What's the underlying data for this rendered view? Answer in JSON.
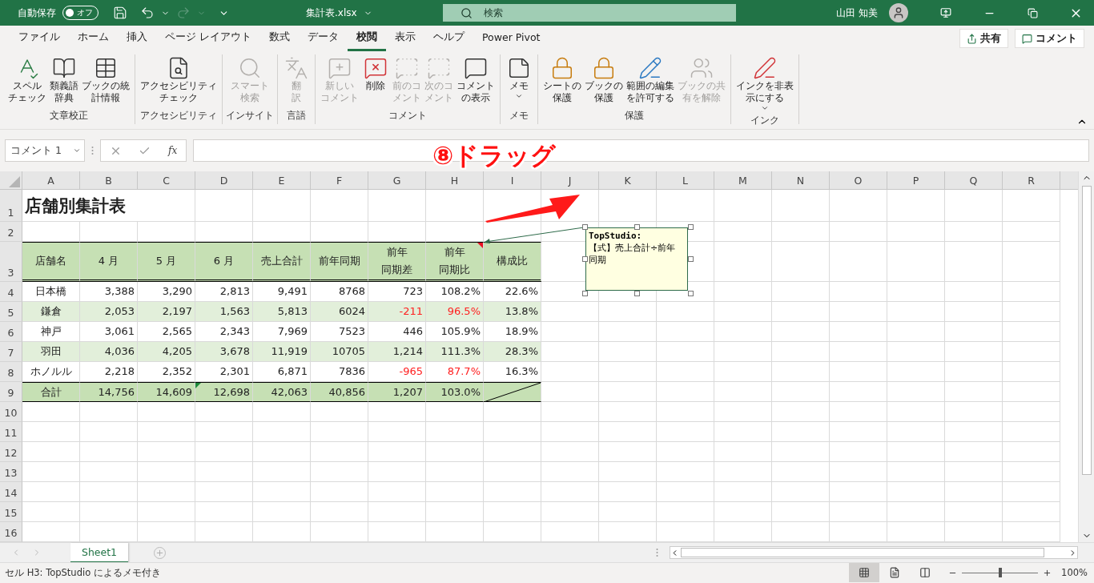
{
  "title_bar": {
    "autosave_label": "自動保存",
    "autosave": {
      "on": false,
      "label": "オフ"
    },
    "file_name": "集計表.xlsx",
    "search": {
      "placeholder": "検索"
    },
    "user_name": "山田 知美"
  },
  "tabs": [
    {
      "label": "ファイル",
      "selected": false
    },
    {
      "label": "ホーム",
      "selected": false
    },
    {
      "label": "挿入",
      "selected": false
    },
    {
      "label": "ページ レイアウト",
      "selected": false
    },
    {
      "label": "数式",
      "selected": false
    },
    {
      "label": "データ",
      "selected": false
    },
    {
      "label": "校閲",
      "selected": true
    },
    {
      "label": "表示",
      "selected": false
    },
    {
      "label": "ヘルプ",
      "selected": false
    },
    {
      "label": "Power Pivot",
      "selected": false
    }
  ],
  "share_button": "共有",
  "comment_button": "コメント",
  "ribbon_groups": [
    {
      "label": "文章校正",
      "buttons": [
        {
          "kind": "spell",
          "label": [
            "スペル",
            "チェック"
          ],
          "disabled": false,
          "dropdown": false
        },
        {
          "kind": "thesaurus",
          "label": [
            "類義語",
            "辞典"
          ],
          "disabled": false,
          "dropdown": false
        },
        {
          "kind": "stats",
          "label": [
            "ブックの統",
            "計情報"
          ],
          "disabled": false,
          "dropdown": false
        }
      ]
    },
    {
      "label": "アクセシビリティ",
      "buttons": [
        {
          "kind": "accessibility",
          "label": [
            "アクセシビリティ",
            "チェック"
          ],
          "disabled": false,
          "dropdown": false
        }
      ]
    },
    {
      "label": "インサイト",
      "buttons": [
        {
          "kind": "lookup",
          "label": [
            "スマート",
            "検索"
          ],
          "disabled": true,
          "dropdown": false
        }
      ]
    },
    {
      "label": "言語",
      "buttons": [
        {
          "kind": "translate",
          "label": [
            "翻",
            "訳"
          ],
          "disabled": true,
          "dropdown": false
        }
      ]
    },
    {
      "label": "コメント",
      "buttons": [
        {
          "kind": "new_comment",
          "label": [
            "新しい",
            "コメント"
          ],
          "disabled": true,
          "dropdown": false
        },
        {
          "kind": "delete_comment",
          "label": [
            "削除"
          ],
          "disabled": false,
          "dropdown": false
        },
        {
          "kind": "prev_comment",
          "label": [
            "前のコ",
            "メント"
          ],
          "disabled": true,
          "dropdown": false
        },
        {
          "kind": "next_comment",
          "label": [
            "次のコ",
            "メント"
          ],
          "disabled": true,
          "dropdown": false
        },
        {
          "kind": "show_comments",
          "label": [
            "コメント",
            "の表示"
          ],
          "disabled": false,
          "dropdown": false
        }
      ]
    },
    {
      "label": "メモ",
      "buttons": [
        {
          "kind": "memo",
          "label": [
            "メモ"
          ],
          "disabled": false,
          "dropdown": true
        }
      ]
    },
    {
      "label": "保護",
      "buttons": [
        {
          "kind": "protect_sheet",
          "label": [
            "シートの",
            "保護"
          ],
          "disabled": false,
          "dropdown": false
        },
        {
          "kind": "protect_book",
          "label": [
            "ブックの",
            "保護"
          ],
          "disabled": false,
          "dropdown": false
        },
        {
          "kind": "allow_edit",
          "label": [
            "範囲の編集",
            "を許可する"
          ],
          "disabled": false,
          "dropdown": false
        },
        {
          "kind": "unshare",
          "label": [
            "ブックの共",
            "有を解除"
          ],
          "disabled": true,
          "dropdown": false
        }
      ]
    },
    {
      "label": "インク",
      "buttons": [
        {
          "kind": "ink",
          "label": [
            "インクを非表",
            "示にする"
          ],
          "disabled": false,
          "dropdown": true
        }
      ]
    }
  ],
  "formula_bar": {
    "name_box": "コメント 1",
    "fx": "fx"
  },
  "columns": [
    "A",
    "B",
    "C",
    "D",
    "E",
    "F",
    "G",
    "H",
    "I",
    "J",
    "K",
    "L",
    "M",
    "N",
    "O",
    "P",
    "Q",
    "R"
  ],
  "rows": [
    {
      "number": "1",
      "kind": "title",
      "cells": [
        "店舗別集計表"
      ]
    },
    {
      "number": "2",
      "kind": "blank"
    },
    {
      "number": "3",
      "kind": "header",
      "cells": [
        "店舗名",
        "4 月",
        "5 月",
        "6 月",
        "売上合計",
        "前年同期",
        [
          "前年",
          "同期差"
        ],
        {
          "text": [
            "前年",
            "同期比"
          ],
          "comment": true
        },
        "構成比"
      ]
    },
    {
      "number": "4",
      "kind": "data",
      "shaded": false,
      "cells": [
        "日本橋",
        "3,388",
        "3,290",
        "2,813",
        "9,491",
        "8768",
        "723",
        "108.2%",
        "22.6%"
      ]
    },
    {
      "number": "5",
      "kind": "data",
      "shaded": true,
      "cells": [
        "鎌倉",
        "2,053",
        "2,197",
        "1,563",
        "5,813",
        "6024",
        {
          "text": "-211",
          "negative": true
        },
        {
          "text": "96.5%",
          "negative": true
        },
        "13.8%"
      ]
    },
    {
      "number": "6",
      "kind": "data",
      "shaded": false,
      "cells": [
        "神戸",
        "3,061",
        "2,565",
        "2,343",
        "7,969",
        "7523",
        "446",
        "105.9%",
        "18.9%"
      ]
    },
    {
      "number": "7",
      "kind": "data",
      "shaded": true,
      "cells": [
        "羽田",
        "4,036",
        "4,205",
        "3,678",
        "11,919",
        "10705",
        "1,214",
        "111.3%",
        "28.3%"
      ]
    },
    {
      "number": "8",
      "kind": "data",
      "shaded": false,
      "cells": [
        "ホノルル",
        "2,218",
        "2,352",
        "2,301",
        "6,871",
        "7836",
        {
          "text": "-965",
          "negative": true
        },
        {
          "text": "87.7%",
          "negative": true
        },
        "16.3%"
      ]
    },
    {
      "number": "9",
      "kind": "total",
      "cells": [
        "合計",
        "14,756",
        "14,609",
        {
          "text": "12,698",
          "error": true
        },
        "42,063",
        "40,856",
        "1,207",
        "103.0%"
      ]
    },
    {
      "number": "10",
      "kind": "blank"
    },
    {
      "number": "11",
      "kind": "blank"
    },
    {
      "number": "12",
      "kind": "blank"
    },
    {
      "number": "13",
      "kind": "blank"
    },
    {
      "number": "14",
      "kind": "blank"
    },
    {
      "number": "15",
      "kind": "blank"
    },
    {
      "number": "16",
      "kind": "blank"
    }
  ],
  "comment": {
    "author": "TopStudio:",
    "text": "【式】売上合計÷前年同期"
  },
  "annotation": {
    "label": "⑧ドラッグ"
  },
  "sheet_tabs": [
    {
      "label": "Sheet1",
      "selected": true
    }
  ],
  "status_bar": {
    "text": "セル H3: TopStudio によるメモ付き",
    "views": [
      {
        "kind": "normal",
        "selected": true
      },
      {
        "kind": "page_layout",
        "selected": false
      },
      {
        "kind": "page_break",
        "selected": false
      }
    ],
    "zoom": {
      "level": 0.5,
      "label": "100%"
    }
  }
}
